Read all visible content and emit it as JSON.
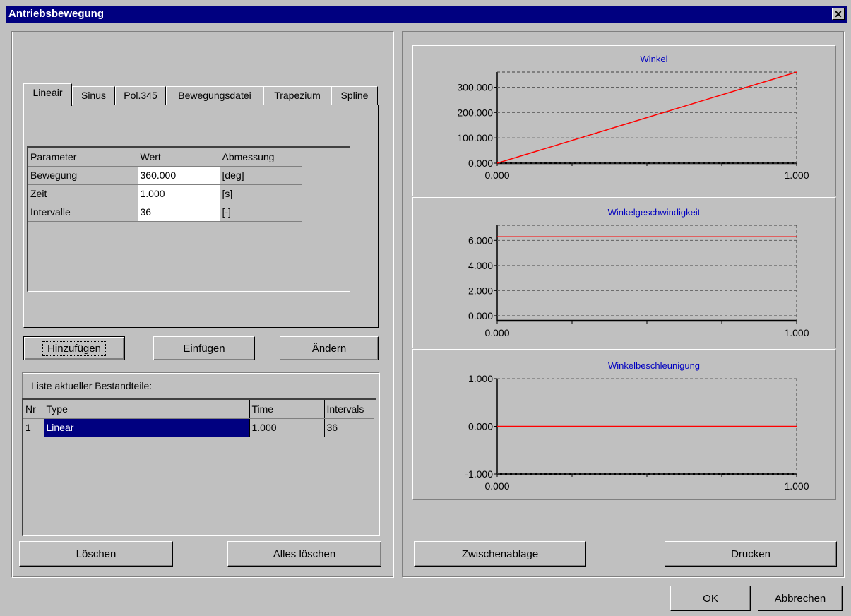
{
  "window": {
    "title": "Antriebsbewegung",
    "close_glyph": "✕"
  },
  "tabs": [
    {
      "label": "Lineair",
      "active": true
    },
    {
      "label": "Sinus"
    },
    {
      "label": "Pol.345"
    },
    {
      "label": "Bewegungsdatei"
    },
    {
      "label": "Trapezium"
    },
    {
      "label": "Spline"
    }
  ],
  "params": {
    "headers": [
      "Parameter",
      "Wert",
      "Abmessung"
    ],
    "rows": [
      [
        "Bewegung",
        "360.000",
        "[deg]"
      ],
      [
        "Zeit",
        "1.000",
        "[s]"
      ],
      [
        "Intervalle",
        "36",
        "[-]"
      ]
    ]
  },
  "buttons": {
    "add": "Hinzufügen",
    "insert": "Einfügen",
    "change": "Ändern",
    "delete": "Löschen",
    "delete_all": "Alles löschen",
    "clipboard": "Zwischenablage",
    "print": "Drucken",
    "ok": "OK",
    "cancel": "Abbrechen"
  },
  "list": {
    "caption": "Liste aktueller Bestandteile:",
    "headers": [
      "Nr",
      "Type",
      "Time",
      "Intervals"
    ],
    "rows": [
      [
        "1",
        "Linear",
        "1.000",
        "36"
      ]
    ]
  },
  "colors": {
    "title_bar": "#000080",
    "chart_title": "#0000c0",
    "series_line": "#ff0000",
    "selection": "#000080"
  },
  "chart_data": [
    {
      "type": "line",
      "title": "Winkel",
      "x": [
        0,
        1
      ],
      "series": [
        {
          "values": [
            0,
            360
          ]
        }
      ],
      "xlim": [
        0,
        1
      ],
      "ylim": [
        0,
        360
      ],
      "yticks": [
        "300.000",
        "200.000",
        "100.000",
        "0.000"
      ],
      "ytick_values": [
        300,
        200,
        100,
        0
      ],
      "xticks": [
        "0.000",
        "1.000"
      ],
      "grid": "horizontal-dashed"
    },
    {
      "type": "line",
      "title": "Winkelgeschwindigkeit",
      "x": [
        0,
        1
      ],
      "series": [
        {
          "values": [
            6.283,
            6.283
          ]
        }
      ],
      "xlim": [
        0,
        1
      ],
      "ylim": [
        -0.4,
        7.2
      ],
      "yticks": [
        "6.000",
        "4.000",
        "2.000",
        "0.000"
      ],
      "ytick_values": [
        6,
        4,
        2,
        0
      ],
      "xticks": [
        "0.000",
        "1.000"
      ],
      "grid": "horizontal-dashed"
    },
    {
      "type": "line",
      "title": "Winkelbeschleunigung",
      "x": [
        0,
        1
      ],
      "series": [
        {
          "values": [
            0,
            0
          ]
        }
      ],
      "xlim": [
        0,
        1
      ],
      "ylim": [
        -1,
        1
      ],
      "yticks": [
        "1.000",
        "0.000",
        "-1.000"
      ],
      "ytick_values": [
        1,
        0,
        -1
      ],
      "xticks": [
        "0.000",
        "1.000"
      ],
      "grid": "horizontal-dashed"
    }
  ]
}
